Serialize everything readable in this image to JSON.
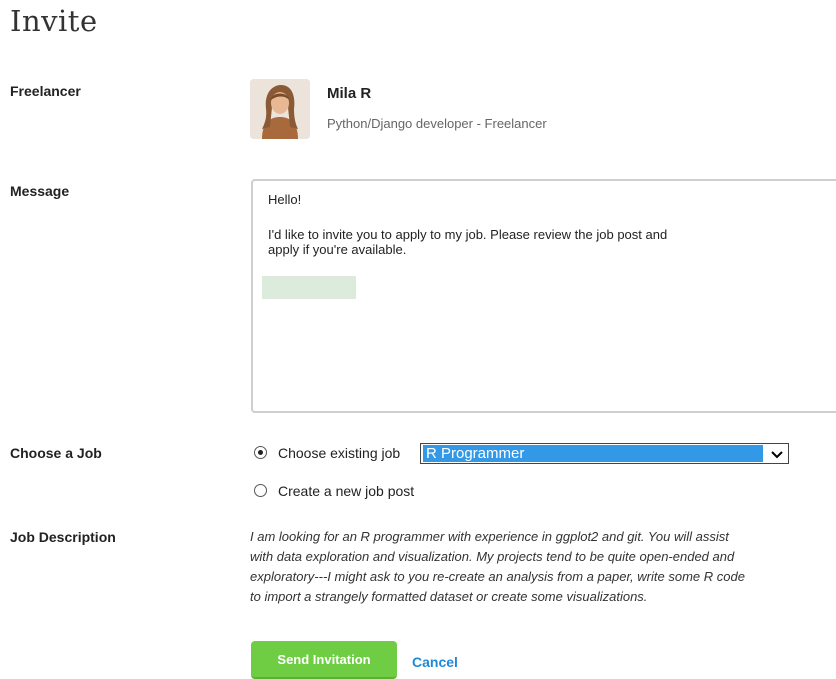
{
  "title": "Invite",
  "freelancer": {
    "label": "Freelancer",
    "name": "Mila R",
    "subtitle": "Python/Django developer - Freelancer"
  },
  "message": {
    "label": "Message",
    "lines": [
      "Hello!",
      "I'd like to invite you to apply to my job. Please review the job post and",
      "apply if you're available."
    ]
  },
  "job": {
    "label": "Choose a Job",
    "existing_label": "Choose existing job",
    "selected_job": "R Programmer",
    "new_label": "Create a new job post",
    "existing_checked": true
  },
  "description": {
    "label": "Job Description",
    "lines": [
      "I am looking for an R programmer with experience in ggplot2 and git. You will assist",
      "with data exploration and visualization. My projects tend to be quite open-ended and",
      "exploratory---I might ask to you re-create an analysis from a paper, write some R code",
      "to import a strangely formatted dataset or create some visualizations."
    ]
  },
  "actions": {
    "send_label": "Send Invitation",
    "cancel_label": "Cancel"
  },
  "colors": {
    "send_button": "#6fcd43",
    "cancel_link": "#1f8ad6",
    "select_highlight": "#3399e6"
  }
}
